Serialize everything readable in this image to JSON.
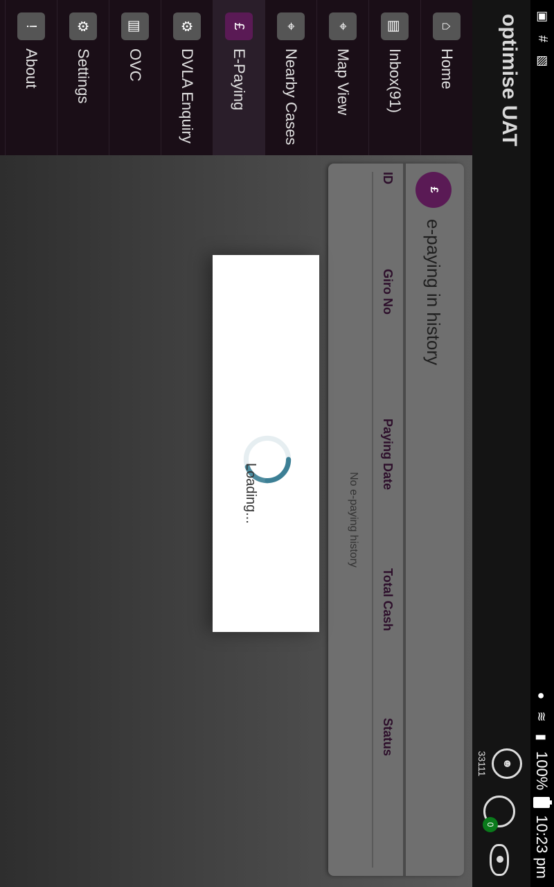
{
  "status_bar": {
    "time": "10:23 pm",
    "battery": "100%",
    "left_icons": [
      "screen-icon",
      "slack-icon",
      "photo-icon"
    ],
    "right_icons": [
      "location-icon",
      "wifi-icon",
      "signal-icon",
      "battery-icon"
    ]
  },
  "app": {
    "title": "optimise UAT",
    "user_id": "33111",
    "globe_badge": "0"
  },
  "nav": {
    "items": [
      {
        "label": "Home",
        "icon": "home-icon",
        "active": false
      },
      {
        "label": "Inbox(91)",
        "icon": "inbox-icon",
        "active": false
      },
      {
        "label": "Map View",
        "icon": "map-icon",
        "active": false
      },
      {
        "label": "Nearby Cases",
        "icon": "nearby-icon",
        "active": false
      },
      {
        "label": "E-Paying",
        "icon": "pound-icon",
        "active": true
      },
      {
        "label": "DVLA Enquiry",
        "icon": "dvla-icon",
        "active": false
      },
      {
        "label": "OVC",
        "icon": "ovc-icon",
        "active": false
      },
      {
        "label": "Settings",
        "icon": "gear-icon",
        "active": false
      },
      {
        "label": "About",
        "icon": "about-icon",
        "active": false
      }
    ]
  },
  "card": {
    "title": "e-paying in history",
    "columns": [
      "ID",
      "Giro No",
      "Paying Date",
      "Total Cash",
      "Status"
    ],
    "empty_message": "No e-paying history"
  },
  "modal": {
    "loading_text": "Loading..."
  },
  "colors": {
    "nav_bg": "#1a0e17",
    "accent": "#5a1a55",
    "spinner": "#3c7f95"
  }
}
